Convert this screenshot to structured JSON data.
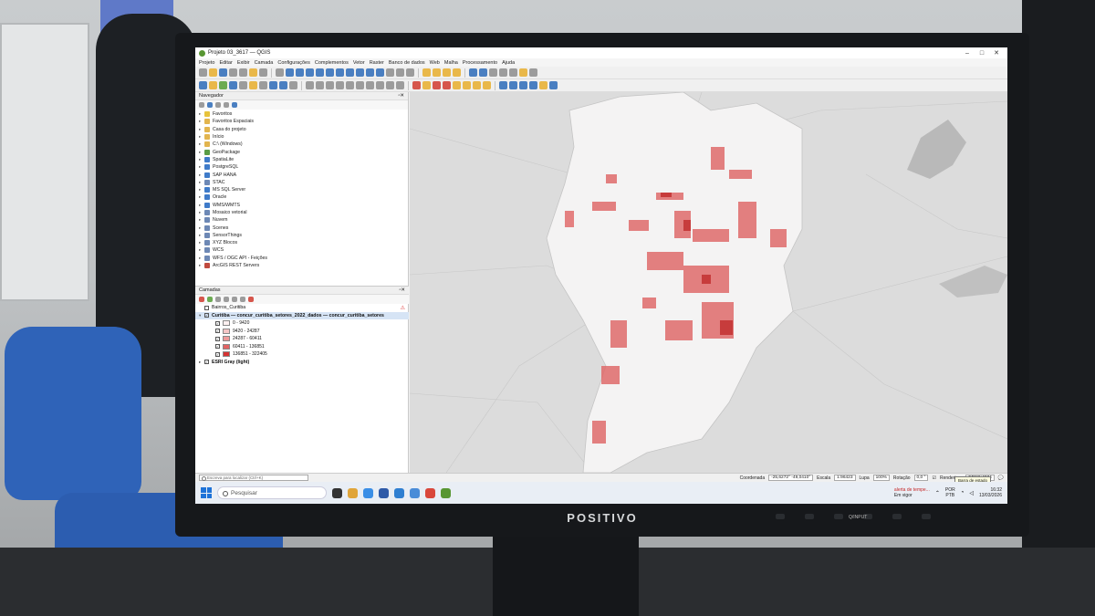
{
  "window": {
    "title": "Projeto 03_3617 — QGIS"
  },
  "menu": [
    "Projeto",
    "Editar",
    "Exibir",
    "Camada",
    "Configurações",
    "Complementos",
    "Vetor",
    "Raster",
    "Banco de dados",
    "Web",
    "Malha",
    "Processamento",
    "Ajuda"
  ],
  "browser_panel": {
    "title": "Navegador",
    "items": [
      {
        "label": "Favoritos",
        "icon": "star-icon"
      },
      {
        "label": "Favoritos Espaciais",
        "icon": "folder-icon"
      },
      {
        "label": "Casa do projeto",
        "icon": "folder-icon"
      },
      {
        "label": "Início",
        "icon": "folder-icon"
      },
      {
        "label": "C:\\ (Windows)",
        "icon": "drive-icon"
      },
      {
        "label": "GeoPackage",
        "icon": "geopackage-icon"
      },
      {
        "label": "SpatiaLite",
        "icon": "spatialite-icon"
      },
      {
        "label": "PostgreSQL",
        "icon": "postgresql-icon"
      },
      {
        "label": "SAP HANA",
        "icon": "database-icon"
      },
      {
        "label": "STAC",
        "icon": "stac-icon"
      },
      {
        "label": "MS SQL Server",
        "icon": "database-icon"
      },
      {
        "label": "Oracle",
        "icon": "database-icon"
      },
      {
        "label": "WMS/WMTS",
        "icon": "wms-icon"
      },
      {
        "label": "Mosaico vetorial",
        "icon": "vector-tile-icon"
      },
      {
        "label": "Nuvem",
        "icon": "cloud-icon"
      },
      {
        "label": "Scenes",
        "icon": "scenes-icon"
      },
      {
        "label": "SensorThings",
        "icon": "sensor-icon"
      },
      {
        "label": "XYZ Blocos",
        "icon": "xyz-icon"
      },
      {
        "label": "WCS",
        "icon": "wcs-icon"
      },
      {
        "label": "WFS / OGC API - Feições",
        "icon": "wfs-icon"
      },
      {
        "label": "ArcGIS REST Servers",
        "icon": "arcgis-icon"
      }
    ]
  },
  "layers_panel": {
    "title": "Camadas",
    "layers": [
      {
        "label": "Bairros_Curitiba",
        "checked": false,
        "warning": true
      },
      {
        "label": "Curitiba — concur_curitiba_setores_2022_dados — concur_curitiba_setores",
        "checked": true
      }
    ],
    "legend": [
      {
        "label": "0 - 9420",
        "color": "#fdf0f0"
      },
      {
        "label": "9420 - 24287",
        "color": "#f5c6c6"
      },
      {
        "label": "24287 - 60411",
        "color": "#ee9a9a"
      },
      {
        "label": "60411 - 136851",
        "color": "#e36464"
      },
      {
        "label": "136851 - 322405",
        "color": "#d63333"
      }
    ],
    "basemap": {
      "label": "ESRI Gray (light)",
      "checked": true
    }
  },
  "statusbar": {
    "locator_placeholder": "Escreva para localizar (Ctrl+K)",
    "coord_label": "Coordenada",
    "coord_value": "-25,6272° -49,0410°",
    "scale_label": "Escala",
    "scale_value": "1:96423",
    "magnifier_label": "Lupa",
    "magnifier_value": "100%",
    "rotation_label": "Rotação",
    "rotation_value": "0,0 °",
    "render_label": "Renderizar",
    "crs_value": "EPSG:4674",
    "tooltip": "Barra de estado"
  },
  "taskbar": {
    "search_placeholder": "Pesquisar",
    "notification_title": "alerta de tempe...",
    "notification_sub": "Em vigor",
    "lang": "POR",
    "layout": "PTB",
    "time": "16:32",
    "date": "13/03/2026"
  },
  "monitor": {
    "brand": "POSITIVO",
    "button_label": "Q/INPUT"
  },
  "colors": {
    "accent": "#d63333",
    "qgis_green": "#589632"
  }
}
